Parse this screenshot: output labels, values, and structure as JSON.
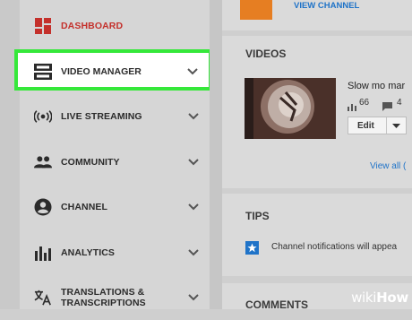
{
  "sidebar": {
    "items": [
      {
        "label": "DASHBOARD",
        "icon": "dashboard-icon"
      },
      {
        "label": "VIDEO MANAGER",
        "icon": "video-manager-icon"
      },
      {
        "label": "LIVE STREAMING",
        "icon": "live-streaming-icon"
      },
      {
        "label": "COMMUNITY",
        "icon": "community-icon"
      },
      {
        "label": "CHANNEL",
        "icon": "channel-icon"
      },
      {
        "label": "ANALYTICS",
        "icon": "analytics-icon"
      },
      {
        "label": "TRANSLATIONS &",
        "label2": "TRANSCRIPTIONS",
        "icon": "translate-icon"
      }
    ]
  },
  "channel_card": {
    "view_channel": "VIEW CHANNEL"
  },
  "videos_card": {
    "title": "VIDEOS",
    "video_title": "Slow mo mar",
    "views": "66",
    "comments": "4",
    "edit_label": "Edit",
    "view_all": "View all ("
  },
  "tips_card": {
    "title": "TIPS",
    "tip_text": "Channel notifications will appea"
  },
  "comments_card": {
    "title": "COMMENTS"
  },
  "watermark": {
    "prefix": "wiki",
    "suffix": "How"
  },
  "colors": {
    "accent_red": "#c4302b",
    "highlight_green": "#35e83a",
    "link_blue": "#1f73c8",
    "orange": "#e67e22"
  }
}
